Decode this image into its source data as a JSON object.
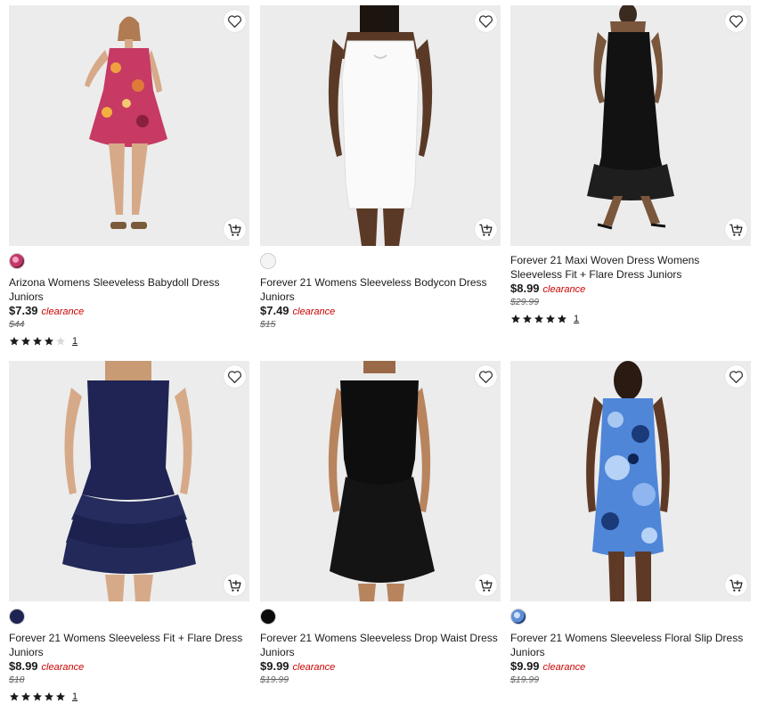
{
  "products": [
    {
      "title": "Arizona Womens Sleeveless Babydoll Dress Juniors",
      "price": "$7.39",
      "badge": "clearance",
      "original_price": "$44",
      "rating": 4,
      "reviews": "1",
      "swatch_color": "#c2386a",
      "dress_color": "#c63a63"
    },
    {
      "title": "Forever 21 Womens Sleeveless Bodycon Dress Juniors",
      "price": "$7.49",
      "badge": "clearance",
      "original_price": "$15",
      "rating": null,
      "reviews": "",
      "swatch_color": "#f4f4f4",
      "dress_color": "#fafafa"
    },
    {
      "title": "Forever 21 Maxi Woven Dress Womens Sleeveless Fit + Flare Dress Juniors",
      "price": "$8.99",
      "badge": "clearance",
      "original_price": "$29.99",
      "rating": 5,
      "reviews": "1",
      "swatch_color": null,
      "dress_color": "#121212"
    },
    {
      "title": "Forever 21 Womens Sleeveless Fit + Flare Dress Juniors",
      "price": "$8.99",
      "badge": "clearance",
      "original_price": "$18",
      "rating": 5,
      "reviews": "1",
      "swatch_color": "#1d2352",
      "dress_color": "#1f2454"
    },
    {
      "title": "Forever 21 Womens Sleeveless Drop Waist Dress Juniors",
      "price": "$9.99",
      "badge": "clearance",
      "original_price": "$19.99",
      "rating": null,
      "reviews": "",
      "swatch_color": "#0b0b0b",
      "dress_color": "#0e0e0e"
    },
    {
      "title": "Forever 21 Womens Sleeveless Floral Slip Dress Juniors",
      "price": "$9.99",
      "badge": "clearance",
      "original_price": "$19.99",
      "rating": null,
      "reviews": "",
      "swatch_color": "#5d8fd6",
      "dress_color": "#4f86d8"
    }
  ],
  "colors": {
    "clearance_red": "#cc0000",
    "star_fill": "#1a1a1a",
    "star_empty": "#d9d9d9",
    "image_bg": "#ebebeb"
  },
  "icons": {
    "favorite": "heart-outline-icon",
    "add_to_cart": "cart-plus-icon",
    "rating": "star-icon"
  }
}
